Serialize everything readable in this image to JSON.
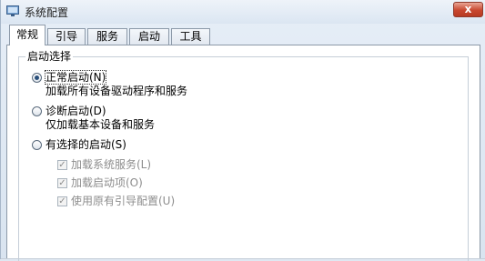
{
  "window": {
    "title": "系统配置",
    "close_glyph": "x",
    "app_icon": "monitor-icon"
  },
  "tabs": [
    {
      "label": "常规",
      "active": true
    },
    {
      "label": "引导",
      "active": false
    },
    {
      "label": "服务",
      "active": false
    },
    {
      "label": "启动",
      "active": false
    },
    {
      "label": "工具",
      "active": false
    }
  ],
  "startup_selection": {
    "group_label": "启动选择",
    "normal": {
      "label": "正常启动(N)",
      "description": "加载所有设备驱动程序和服务",
      "selected": true
    },
    "diagnostic": {
      "label": "诊断启动(D)",
      "description": "仅加载基本设备和服务",
      "selected": false
    },
    "selective": {
      "label": "有选择的启动(S)",
      "selected": false,
      "options": [
        {
          "label": "加载系统服务(L)",
          "checked": true,
          "enabled": false
        },
        {
          "label": "加载启动项(O)",
          "checked": true,
          "enabled": false
        },
        {
          "label": "使用原有引导配置(U)",
          "checked": true,
          "enabled": false
        }
      ]
    }
  },
  "colors": {
    "window_background": "#dfe8f2",
    "close_button": "#c8472f",
    "disabled_text": "#8d8d8d",
    "radio_dot": "#2a4f7a"
  }
}
